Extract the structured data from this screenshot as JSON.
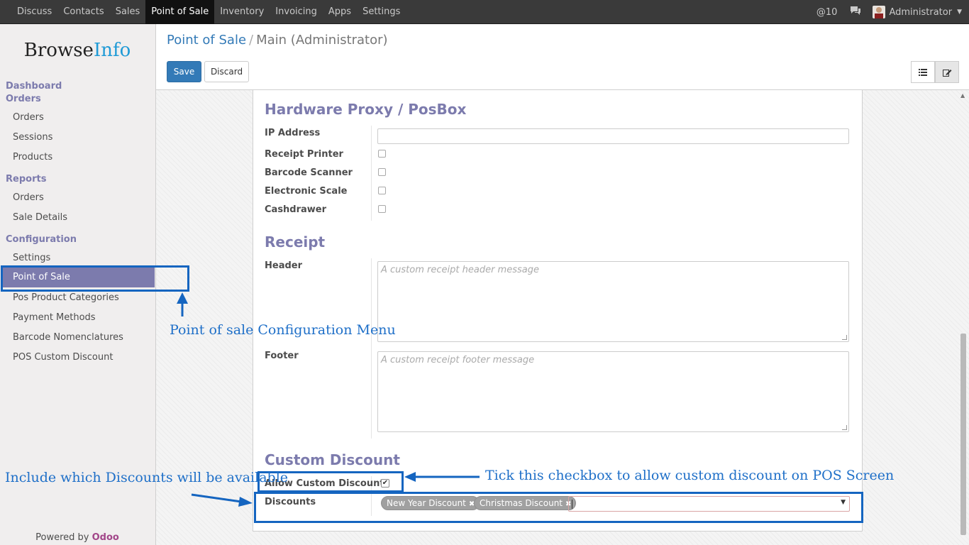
{
  "topnav": {
    "items": [
      "Discuss",
      "Contacts",
      "Sales",
      "Point of Sale",
      "Inventory",
      "Invoicing",
      "Apps",
      "Settings"
    ],
    "active_index": 3,
    "mentions": "10",
    "user": "Administrator"
  },
  "sidebar": {
    "logo_part1": "Browse",
    "logo_part2": "Info",
    "sections": {
      "dashboard": "Dashboard",
      "orders": "Orders",
      "reports": "Reports",
      "configuration": "Configuration"
    },
    "orders_items": [
      "Orders",
      "Sessions",
      "Products"
    ],
    "reports_items": [
      "Orders",
      "Sale Details"
    ],
    "config_items": [
      "Settings",
      "Point of Sale",
      "Pos Product Categories",
      "Payment Methods",
      "Barcode Nomenclatures",
      "POS Custom Discount"
    ],
    "powered_by": "Powered by",
    "powered_brand": "Odoo"
  },
  "control_panel": {
    "breadcrumb_root": "Point of Sale",
    "breadcrumb_sep": "/",
    "breadcrumb_current": "Main (Administrator)",
    "save_label": "Save",
    "discard_label": "Discard"
  },
  "form": {
    "hardware_title": "Hardware Proxy / PosBox",
    "ip_label": "IP Address",
    "ip_value": "",
    "receipt_printer_label": "Receipt Printer",
    "barcode_scanner_label": "Barcode Scanner",
    "electronic_scale_label": "Electronic Scale",
    "cashdrawer_label": "Cashdrawer",
    "receipt_title": "Receipt",
    "header_label": "Header",
    "header_placeholder": "A custom receipt header message",
    "footer_label": "Footer",
    "footer_placeholder": "A custom receipt footer message",
    "custom_discount_title": "Custom Discount",
    "allow_custom_discount_label": "Allow Custom Discount",
    "allow_custom_discount_checked": true,
    "discounts_label": "Discounts",
    "discount_tags": [
      "New Year Discount",
      "Christmas Discount"
    ]
  },
  "annotations": {
    "menu_note": "Point of sale Configuration Menu",
    "checkbox_note": "Tick this checkbox to allow custom discount on POS Screen",
    "discounts_note": "Include which Discounts will be available"
  },
  "colors": {
    "accent": "#7c7bad",
    "primary_button": "#337ab7",
    "annotation": "#1565c0"
  }
}
